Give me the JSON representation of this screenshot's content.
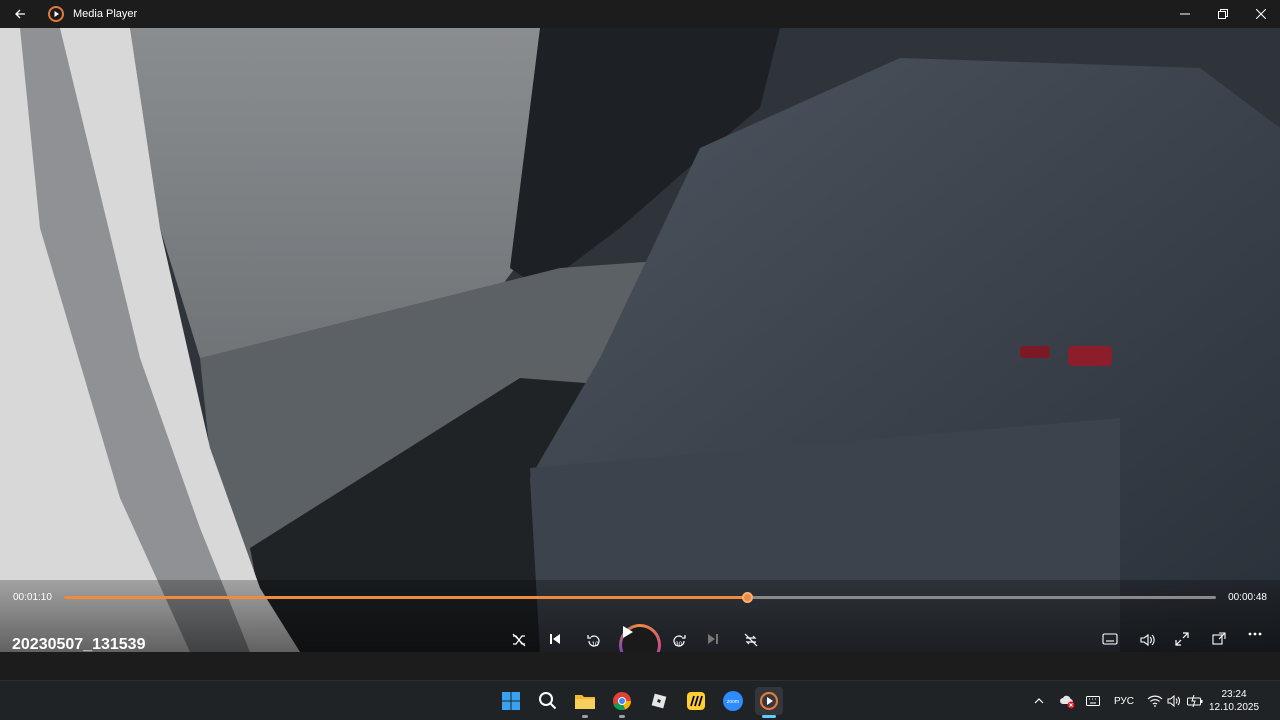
{
  "window": {
    "title": "Media Player"
  },
  "player": {
    "elapsed": "00:01:10",
    "remaining": "00:00:48",
    "progress": 0.593,
    "filename": "20230507_131539"
  },
  "taskbar": {
    "language": "РУС",
    "time": "23:24",
    "date": "12.10.2025",
    "zoom_label": "zoom"
  },
  "colors": {
    "accent": "#f08a3c",
    "titlebar": "#1c1c1c",
    "taskbar": "#202326"
  }
}
